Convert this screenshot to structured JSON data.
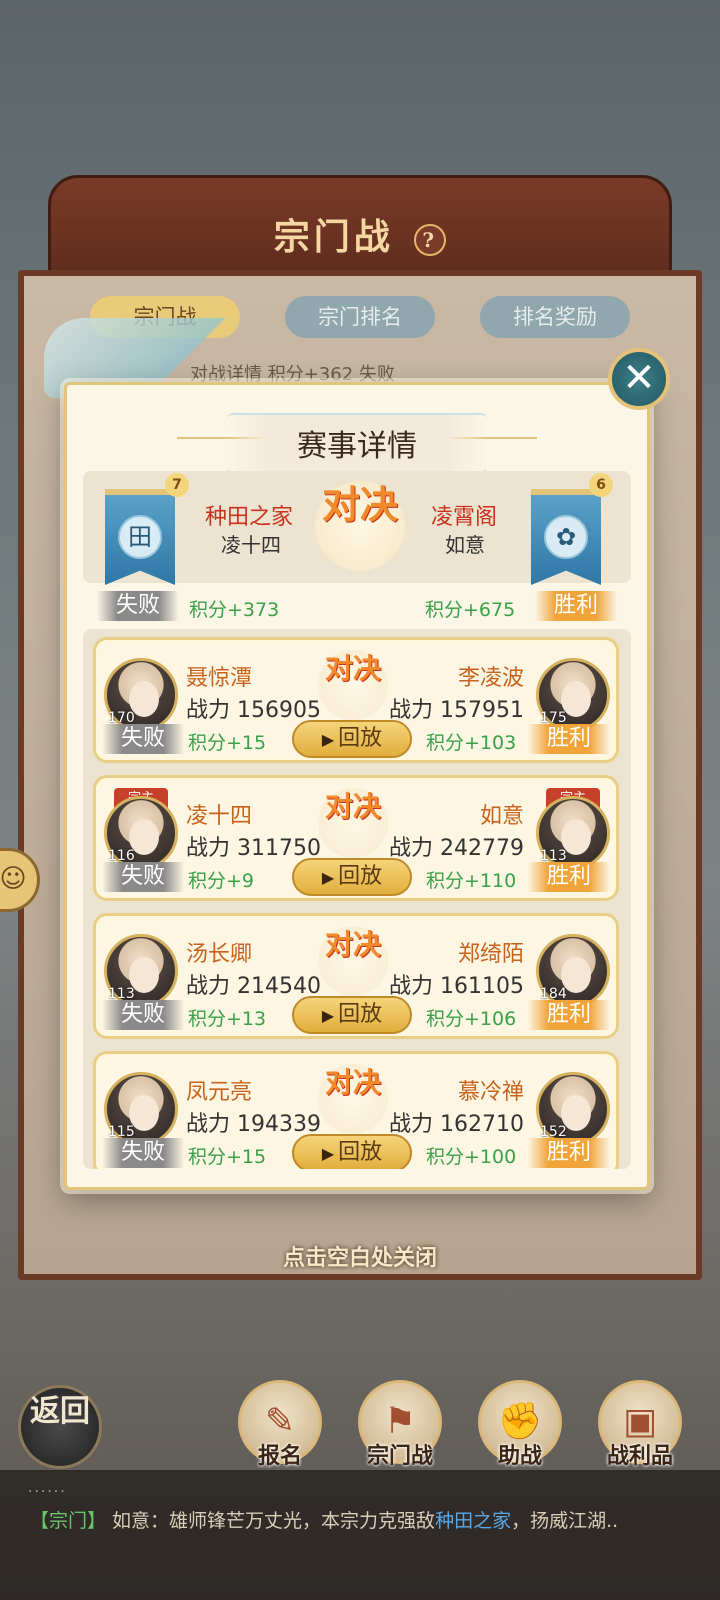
{
  "background": {
    "title": "宗门战",
    "help_icon": "?",
    "tabs": [
      "宗门战",
      "宗门排名",
      "排名奖励"
    ],
    "row_peek": "对战详情   积分+362   失败"
  },
  "modal": {
    "title": "赛事详情",
    "close_icon": "close-icon",
    "clan_left": {
      "name": "种田之家",
      "leader": "凌十四",
      "emblem": "田",
      "rank": "7",
      "result": "失败",
      "score": "积分+373"
    },
    "clan_right": {
      "name": "凌霄阁",
      "leader": "如意",
      "emblem": "✿",
      "rank": "6",
      "result": "胜利",
      "score": "积分+675"
    },
    "vs_text": "对决",
    "matches": [
      {
        "left": {
          "name": "聂惊潭",
          "power": "战力 156905",
          "level": "170",
          "result": "失败",
          "score": "积分+15",
          "leader": ""
        },
        "right": {
          "name": "李凌波",
          "power": "战力 157951",
          "level": "175",
          "result": "胜利",
          "score": "积分+103",
          "leader": ""
        },
        "replay": "回放"
      },
      {
        "left": {
          "name": "凌十四",
          "power": "战力 311750",
          "level": "116",
          "result": "失败",
          "score": "积分+9",
          "leader": "宗主"
        },
        "right": {
          "name": "如意",
          "power": "战力 242779",
          "level": "113",
          "result": "胜利",
          "score": "积分+110",
          "leader": "宗主"
        },
        "replay": "回放"
      },
      {
        "left": {
          "name": "汤长卿",
          "power": "战力 214540",
          "level": "113",
          "result": "失败",
          "score": "积分+13",
          "leader": ""
        },
        "right": {
          "name": "郑绮陌",
          "power": "战力 161105",
          "level": "184",
          "result": "胜利",
          "score": "积分+106",
          "leader": ""
        },
        "replay": "回放"
      },
      {
        "left": {
          "name": "凤元亮",
          "power": "战力 194339",
          "level": "115",
          "result": "失败",
          "score": "积分+15",
          "leader": ""
        },
        "right": {
          "name": "慕冷禅",
          "power": "战力 162710",
          "level": "152",
          "result": "胜利",
          "score": "积分+100",
          "leader": ""
        },
        "replay": "回放"
      }
    ]
  },
  "hint": "点击空白处关闭",
  "side_chat_icon": "chat-bubble-icon",
  "back_button": "返回",
  "bottom_nav": [
    {
      "label": "报名",
      "icon": "scroll-icon"
    },
    {
      "label": "宗门战",
      "icon": "flag-mountain-icon"
    },
    {
      "label": "助战",
      "icon": "handshake-icon"
    },
    {
      "label": "战利品",
      "icon": "treasure-chest-icon"
    }
  ],
  "chat": {
    "dots": "......",
    "tag": "【宗门】",
    "text_before": " 如意：雄师锋芒万丈光，本宗力克强敌",
    "highlight": "种田之家",
    "text_after": "，扬威江湖.."
  },
  "colors": {
    "win": "#f0a43a",
    "lose": "#8a8a8a",
    "score": "#3ba04a",
    "name": "#c8631e",
    "accent": "#e2c57a"
  }
}
